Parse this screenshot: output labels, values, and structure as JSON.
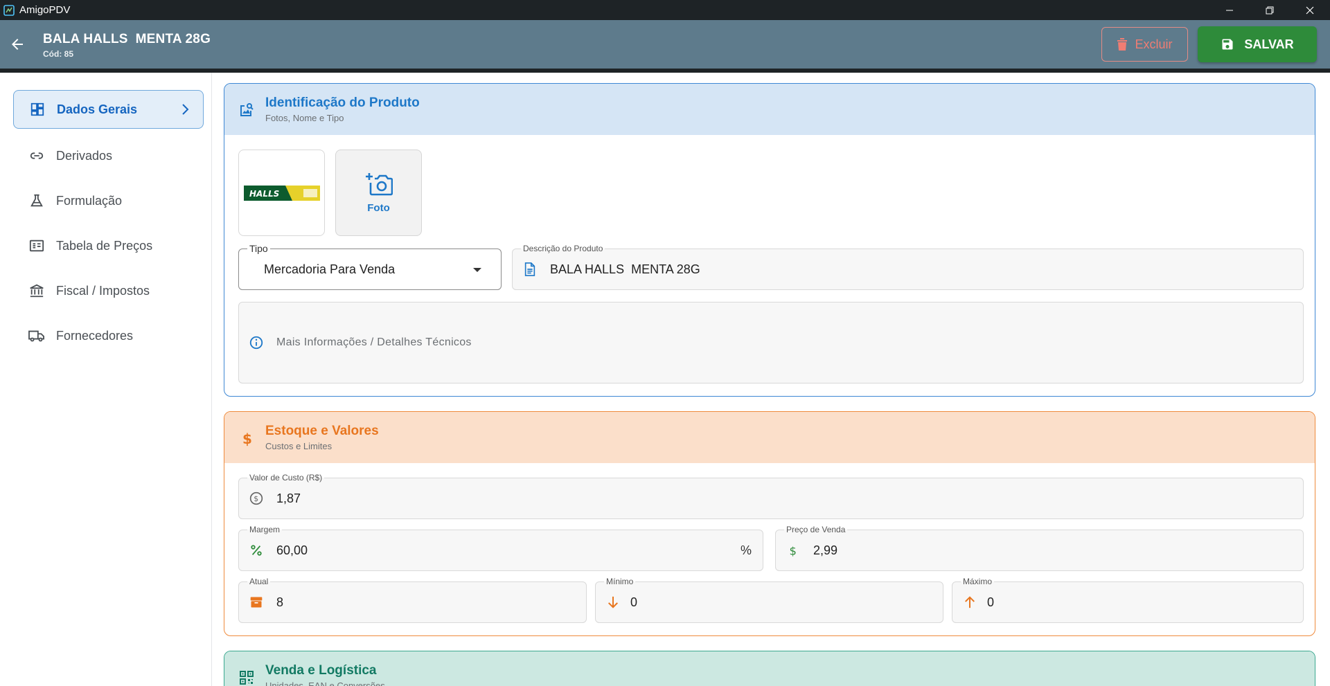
{
  "window": {
    "app_name": "AmigoPDV"
  },
  "header": {
    "product_title": "BALA HALLS  MENTA 28G",
    "product_code": "Cód: 85",
    "delete_label": "Excluir",
    "save_label": "SALVAR"
  },
  "sidebar": {
    "items": [
      {
        "label": "Dados Gerais",
        "icon": "dashboard-icon",
        "active": true
      },
      {
        "label": "Derivados",
        "icon": "link-icon"
      },
      {
        "label": "Formulação",
        "icon": "flask-icon"
      },
      {
        "label": "Tabela de Preços",
        "icon": "price-list-icon"
      },
      {
        "label": "Fiscal / Impostos",
        "icon": "bank-icon"
      },
      {
        "label": "Fornecedores",
        "icon": "truck-icon"
      }
    ]
  },
  "identificacao": {
    "title": "Identificação do Produto",
    "subtitle": "Fotos, Nome e Tipo",
    "photo_label": "Foto",
    "tipo_label": "Tipo",
    "tipo_value": "Mercadoria Para Venda",
    "descricao_label": "Descrição do Produto",
    "descricao_value": "BALA HALLS  MENTA 28G",
    "info_text": "Mais Informações / Detalhes Técnicos"
  },
  "estoque": {
    "title": "Estoque e Valores",
    "subtitle": "Custos e Limites",
    "custo_label": "Valor de Custo (R$)",
    "custo_value": "1,87",
    "margem_label": "Margem",
    "margem_value": "60,00",
    "margem_suffix": "%",
    "preco_label": "Preço de Venda",
    "preco_value": "2,99",
    "atual_label": "Atual",
    "atual_value": "8",
    "minimo_label": "Mínimo",
    "minimo_value": "0",
    "maximo_label": "Máximo",
    "maximo_value": "0"
  },
  "venda": {
    "title": "Venda e Logística",
    "subtitle": "Unidades, EAN e Conversões"
  },
  "colors": {
    "header_bg": "#5e7b8c",
    "save_green": "#2e8b3a",
    "delete_red": "#f07d73",
    "blue_accent": "#1e78c8",
    "orange_accent": "#e8761f",
    "teal_accent": "#127a63"
  }
}
